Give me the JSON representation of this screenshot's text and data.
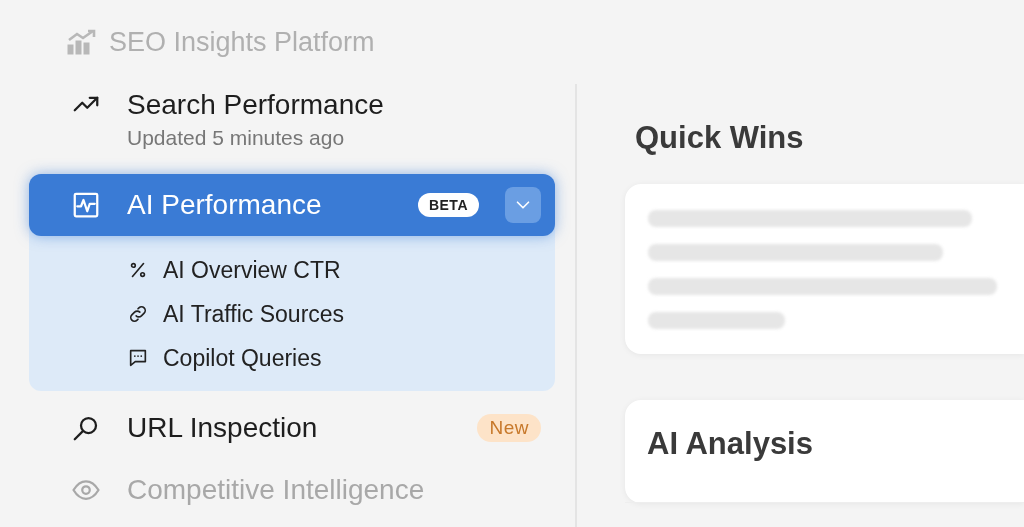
{
  "app": {
    "title": "SEO Insights Platform"
  },
  "sidebar": {
    "items": [
      {
        "label": "Search Performance",
        "subtitle": "Updated 5 minutes ago",
        "selected": false,
        "expanded": false,
        "disabled": false
      },
      {
        "label": "AI Performance",
        "badge": {
          "text": "BETA",
          "kind": "beta"
        },
        "selected": true,
        "expanded": true,
        "disabled": false,
        "children": [
          {
            "label": "AI Overview CTR"
          },
          {
            "label": "AI Traffic Sources"
          },
          {
            "label": "Copilot Queries"
          }
        ]
      },
      {
        "label": "URL Inspection",
        "badge": {
          "text": "New",
          "kind": "new"
        },
        "selected": false,
        "expanded": false,
        "disabled": false
      },
      {
        "label": "Competitive Intelligence",
        "selected": false,
        "expanded": false,
        "disabled": true
      }
    ]
  },
  "content": {
    "cards": [
      {
        "title": "Quick Wins",
        "kind": "skeleton"
      },
      {
        "title": "AI Analysis",
        "kind": "titled"
      }
    ]
  }
}
